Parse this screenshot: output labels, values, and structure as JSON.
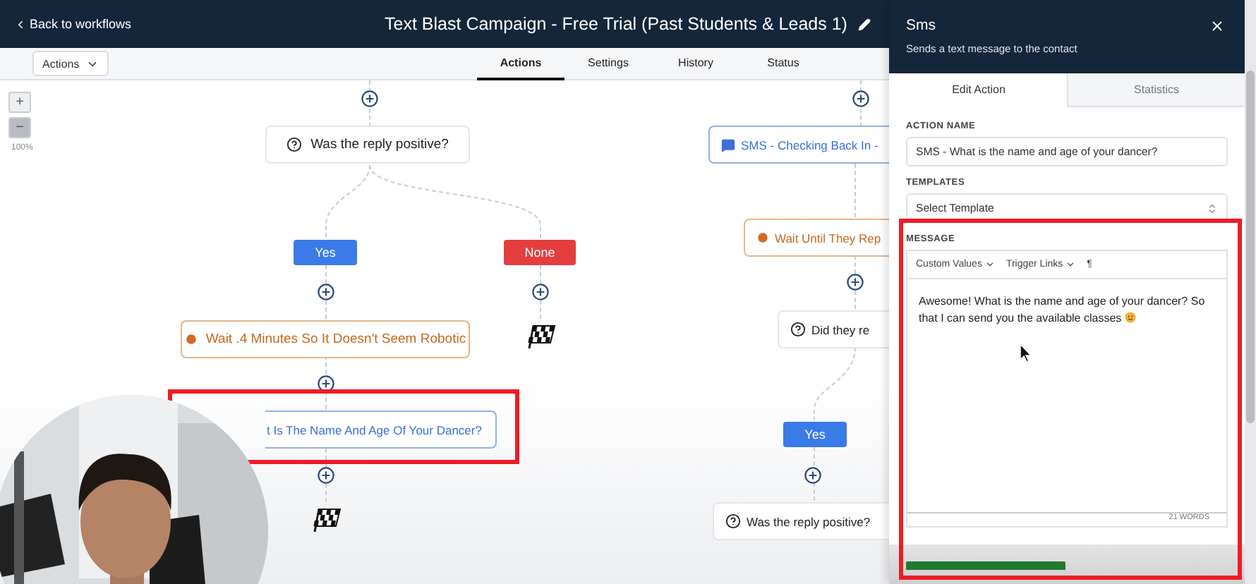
{
  "header": {
    "back_link": "Back to workflows",
    "title": "Text Blast Campaign - Free Trial (Past Students & Leads 1)"
  },
  "toolbar": {
    "actions_menu": "Actions",
    "tabs": [
      {
        "label": "Actions",
        "selected": true
      },
      {
        "label": "Settings",
        "selected": false
      },
      {
        "label": "History",
        "selected": false
      },
      {
        "label": "Status",
        "selected": false
      }
    ]
  },
  "zoom": {
    "plus": "+",
    "minus": "−",
    "level": "100%"
  },
  "canvas": {
    "nodes": [
      {
        "kind": "condition",
        "label": "Was the reply positive?"
      },
      {
        "kind": "sms",
        "label": "SMS - Checking Back In -"
      },
      {
        "kind": "wait",
        "label": "Wait Until They Rep"
      },
      {
        "kind": "branch",
        "label": "Yes",
        "color": "#3b7be8"
      },
      {
        "kind": "branch",
        "label": "None",
        "color": "#e53e3e"
      },
      {
        "kind": "condition",
        "label": "Did they re"
      },
      {
        "kind": "wait",
        "label": "Wait .4 Minutes So It Doesn't Seem Robotic"
      },
      {
        "kind": "end"
      },
      {
        "kind": "action",
        "label": "t Is The Name And Age Of Your Dancer?"
      },
      {
        "kind": "branch",
        "label": "Yes",
        "color": "#3b7be8"
      },
      {
        "kind": "end"
      },
      {
        "kind": "condition",
        "label": "Was the reply positive?"
      }
    ]
  },
  "panel": {
    "title": "Sms",
    "subtitle": "Sends a text message to the contact",
    "tabs": [
      {
        "label": "Edit Action",
        "selected": true
      },
      {
        "label": "Statistics",
        "selected": false
      }
    ],
    "action_name": {
      "label": "ACTION NAME",
      "value": "SMS - What is the name and age of your dancer?"
    },
    "templates": {
      "label": "TEMPLATES",
      "value": "Select Template"
    },
    "message": {
      "label": "MESSAGE",
      "tools": [
        "Custom Values",
        "Trigger Links"
      ],
      "paragraph": "¶",
      "text": "Awesome! What is the name and age of your dancer? So that I can send you the available classes",
      "word_count": "21 WORDS"
    }
  }
}
